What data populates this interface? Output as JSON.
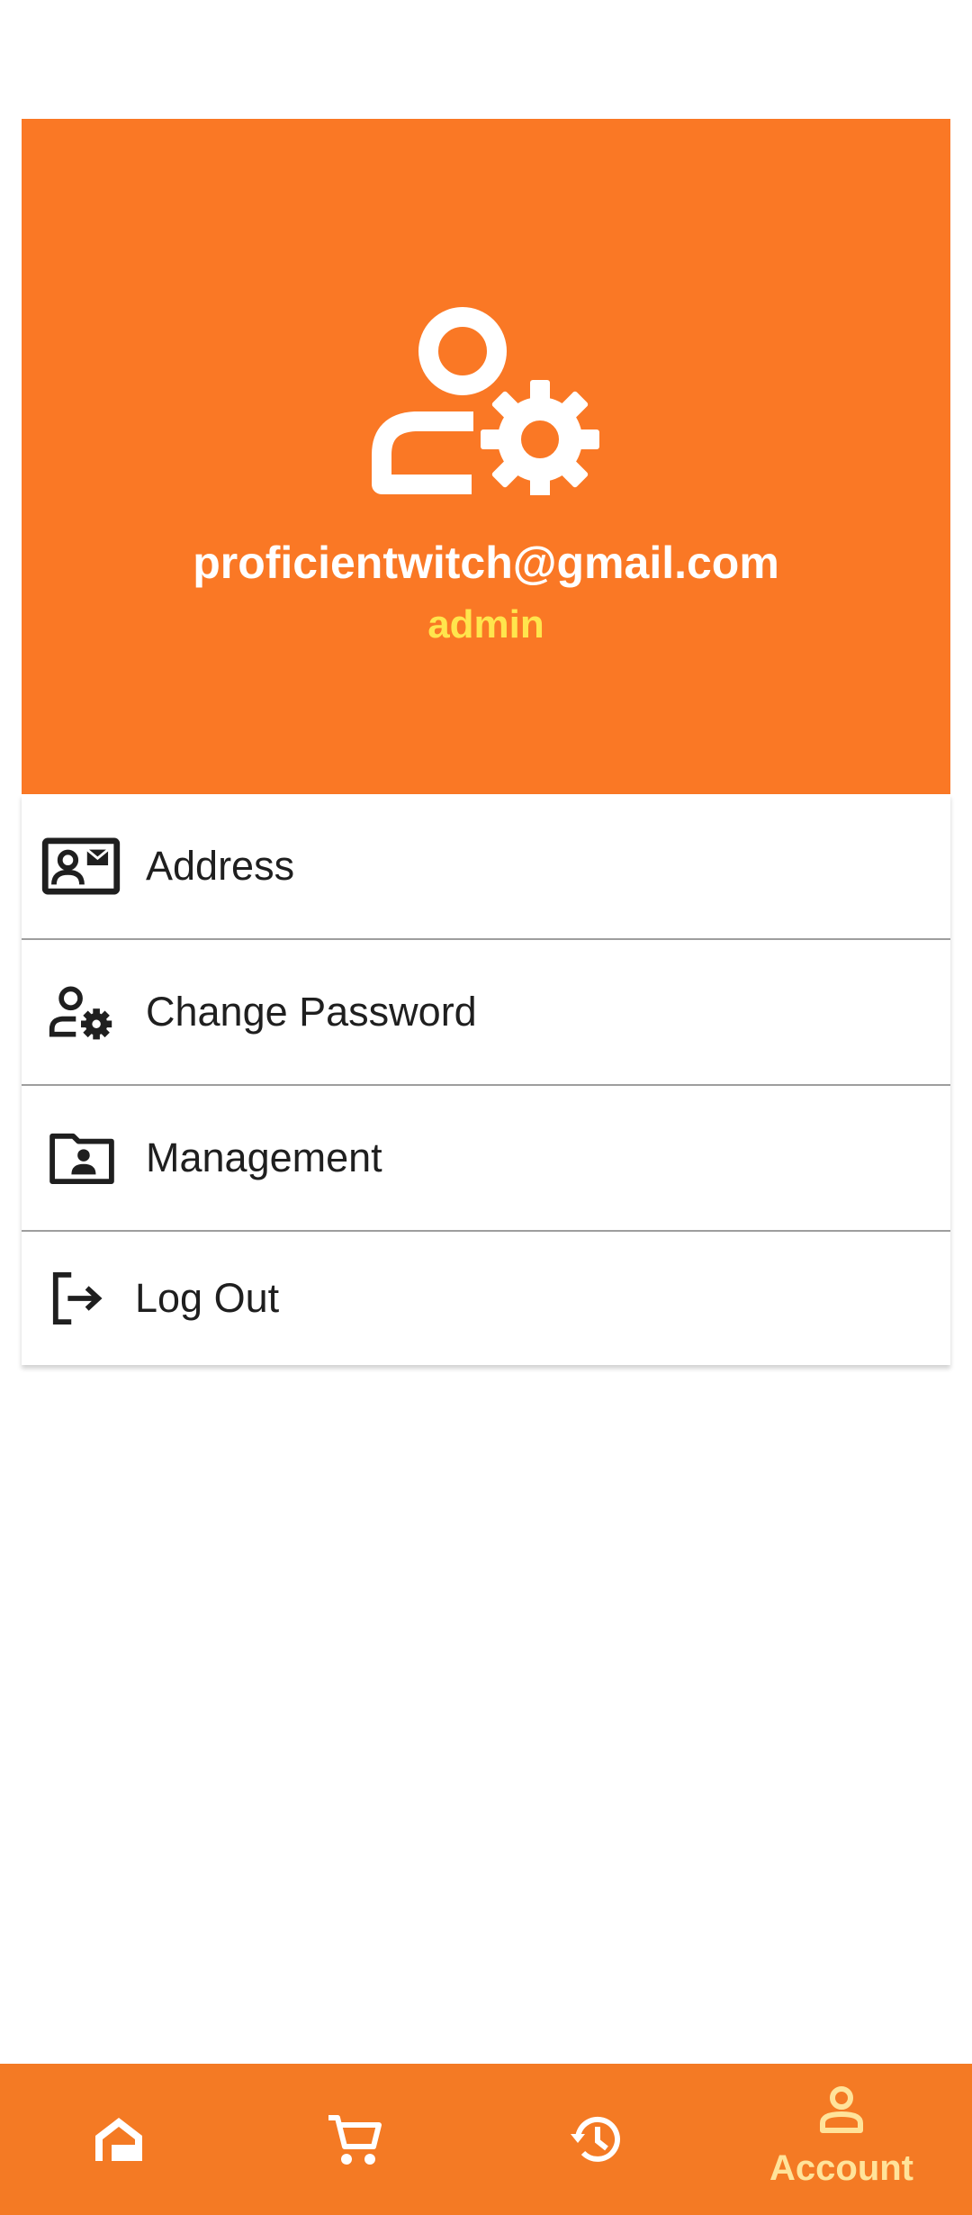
{
  "profile": {
    "email": "proficientwitch@gmail.com",
    "role": "admin",
    "icon": "user-gear-icon",
    "background_color": "#FA7825",
    "role_color": "#FFE54D"
  },
  "menu": {
    "items": [
      {
        "label": "Address",
        "icon": "contact-card-icon"
      },
      {
        "label": "Change Password",
        "icon": "user-gear-icon"
      },
      {
        "label": "Management",
        "icon": "folder-user-icon"
      },
      {
        "label": "Log Out",
        "icon": "logout-icon"
      }
    ]
  },
  "bottom_nav": {
    "background_color": "#F47A24",
    "active_color": "#FFE39A",
    "items": [
      {
        "icon": "home-icon"
      },
      {
        "icon": "cart-icon"
      },
      {
        "icon": "history-icon"
      },
      {
        "icon": "account-icon",
        "label": "Account",
        "active": true
      }
    ]
  }
}
